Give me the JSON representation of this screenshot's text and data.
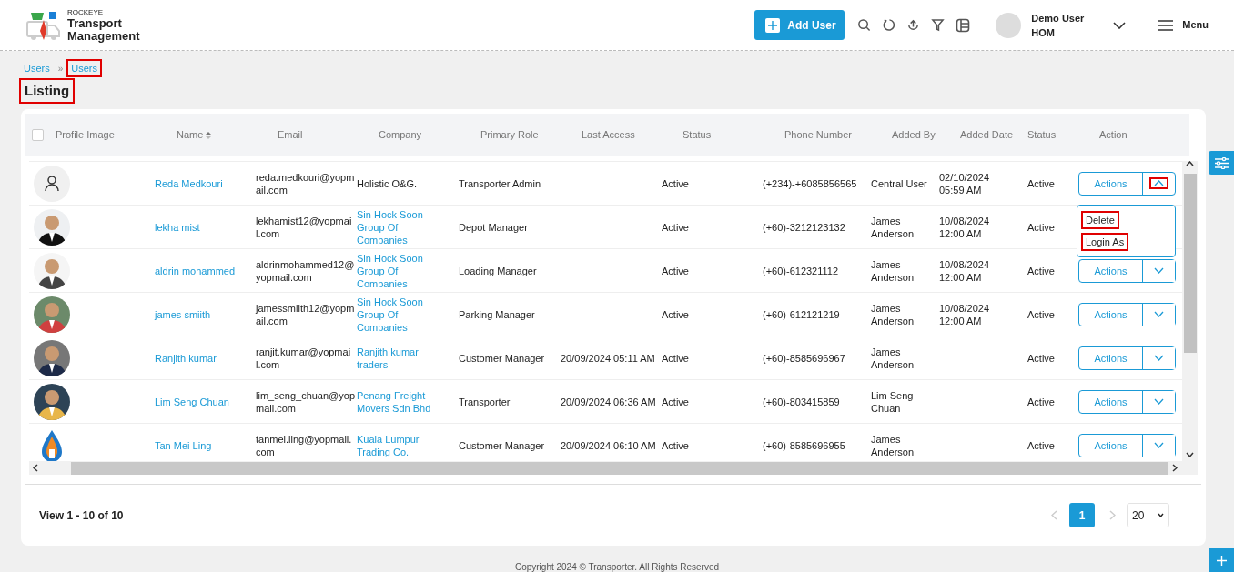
{
  "header": {
    "logo": {
      "brand": "ROCKEYE",
      "line1": "Transport",
      "line2": "Management"
    },
    "add_button": "Add User",
    "user": {
      "name": "Demo User",
      "role": "HOM"
    },
    "menu": "Menu"
  },
  "breadcrumb": {
    "separator": "»",
    "items": [
      {
        "label": "Users",
        "highlighted": false
      },
      {
        "label": "Users",
        "highlighted": true
      }
    ]
  },
  "title": {
    "text": "Listing",
    "highlighted": true
  },
  "table": {
    "select_all": {
      "checked": false
    },
    "columns": [
      {
        "label": "Profile Image",
        "sortable": false
      },
      {
        "label": "Name",
        "sortable": true
      },
      {
        "label": "Email",
        "sortable": false
      },
      {
        "label": "Company",
        "sortable": false
      },
      {
        "label": "Primary Role",
        "sortable": false
      },
      {
        "label": "Last Access",
        "sortable": false
      },
      {
        "label": "Status",
        "sortable": false
      },
      {
        "label": "Phone Number",
        "sortable": false
      },
      {
        "label": "Added By",
        "sortable": false
      },
      {
        "label": "Added Date",
        "sortable": false
      },
      {
        "label": "Status",
        "sortable": false
      },
      {
        "label": "Action",
        "sortable": false
      }
    ],
    "rows": [
      {
        "avatar": {
          "kind": "icon"
        },
        "name": "Reda Medkouri",
        "email": "reda.medkouri@yopmail.com",
        "company": "Holistic O&G.",
        "company_link": false,
        "role": "Transporter Admin",
        "status": "Active",
        "phone": "(+234)-+6085856565",
        "added_by": "Central User",
        "added_date": "02/10/2024 05:59 AM",
        "status_2": "Active",
        "action": "Actions",
        "expanded": true,
        "toggle_highlighted": true,
        "menu": [
          {
            "label": "Delete",
            "highlighted": true
          },
          {
            "label": "Login As",
            "highlighted": true
          }
        ]
      },
      {
        "name": "lekha mist",
        "email": "lekhamist12@yopmail.com",
        "company": "Sin Hock Soon Group Of Companies",
        "company_link": true,
        "role": "Depot Manager",
        "status": "Active",
        "phone": "(+60)-3212123132",
        "added_by": "James Anderson",
        "added_date": "10/08/2024 12:00 AM",
        "status_2": "Active"
      },
      {
        "name": "aldrin mohammed",
        "email": "aldrinmohammed12@yopmail.com",
        "company": "Sin Hock Soon Group Of Companies",
        "company_link": true,
        "role": "Loading Manager",
        "status": "Active",
        "phone": "(+60)-612321112",
        "added_by": "James Anderson",
        "added_date": "10/08/2024 12:00 AM",
        "status_2": "Active",
        "action": "Actions",
        "expanded": false,
        "toggle_highlighted": false
      },
      {
        "name": "james smiith",
        "email": "jamessmiith12@yopmail.com",
        "company": "Sin Hock Soon Group Of Companies",
        "company_link": true,
        "role": "Parking Manager",
        "status": "Active",
        "phone": "(+60)-612121219",
        "added_by": "James Anderson",
        "added_date": "10/08/2024 12:00 AM",
        "status_2": "Active",
        "action": "Actions",
        "expanded": false,
        "toggle_highlighted": false
      },
      {
        "name": "Ranjith kumar",
        "email": "ranjit.kumar@yopmail.com",
        "company": "Ranjith kumar traders",
        "company_link": true,
        "role": "Customer Manager",
        "last_access": "20/09/2024 05:11 AM",
        "status": "Active",
        "phone": "(+60)-8585696967",
        "added_by": "James Anderson",
        "status_2": "Active",
        "action": "Actions",
        "expanded": false,
        "toggle_highlighted": false
      },
      {
        "name": "Lim Seng Chuan",
        "email": "lim_seng_chuan@yopmail.com",
        "company": "Penang Freight Movers Sdn Bhd",
        "company_link": true,
        "role": "Transporter",
        "last_access": "20/09/2024 06:36 AM",
        "status": "Active",
        "phone": "(+60)-803415859",
        "added_by": "Lim Seng Chuan",
        "status_2": "Active",
        "action": "Actions",
        "expanded": false,
        "toggle_highlighted": false
      },
      {
        "avatar": {
          "kind": "logo"
        },
        "name": "Tan Mei Ling",
        "email": "tanmei.ling@yopmail.com",
        "company": "Kuala Lumpur Trading Co.",
        "company_link": true,
        "role": "Customer Manager",
        "last_access": "20/09/2024 06:10 AM",
        "status": "Active",
        "phone": "(+60)-8585696955",
        "added_by": "James Anderson",
        "status_2": "Active",
        "action": "Actions",
        "expanded": false,
        "toggle_highlighted": false
      }
    ]
  },
  "footer": {
    "summary": "View 1 - 10 of 10",
    "pages": [
      {
        "label": "1",
        "selected": true
      }
    ],
    "page_size": "20"
  },
  "copyright": "Copyright 2024 © Transporter. All Rights Reserved"
}
